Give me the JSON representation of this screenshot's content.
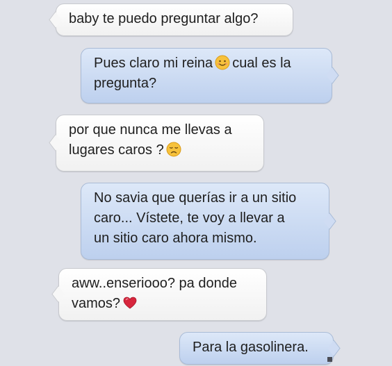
{
  "conversation": {
    "messages": [
      {
        "direction": "incoming",
        "lines": [
          "baby te puedo preguntar algo?"
        ]
      },
      {
        "direction": "outgoing",
        "line1_before_emoji": "Pues claro mi reina",
        "emoji": "smiling-face-emoji",
        "line1_after_emoji": "cual es la",
        "line2": "pregunta?"
      },
      {
        "direction": "incoming",
        "line1": "por que nunca me llevas a",
        "line2_before_emoji": "lugares caros ?",
        "emoji": "sad-face-emoji"
      },
      {
        "direction": "outgoing",
        "lines": [
          "No savia que querías ir a un sitio",
          "caro... Vístete, te voy a llevar a",
          "un sitio caro ahora mismo."
        ]
      },
      {
        "direction": "incoming",
        "line1": "aww..enseriooo? pa donde",
        "line2_before_emoji": "vamos?",
        "emoji": "red-heart-emoji"
      },
      {
        "direction": "outgoing",
        "lines": [
          "Para la gasolinera."
        ]
      }
    ]
  },
  "colors": {
    "background": "#dfe1e8",
    "incoming_bubble": "#f5f5f5",
    "outgoing_bubble": "#cfdcf3",
    "text": "#1e1e1e",
    "emoji_face": "#f7c23c",
    "heart": "#d7263d"
  }
}
